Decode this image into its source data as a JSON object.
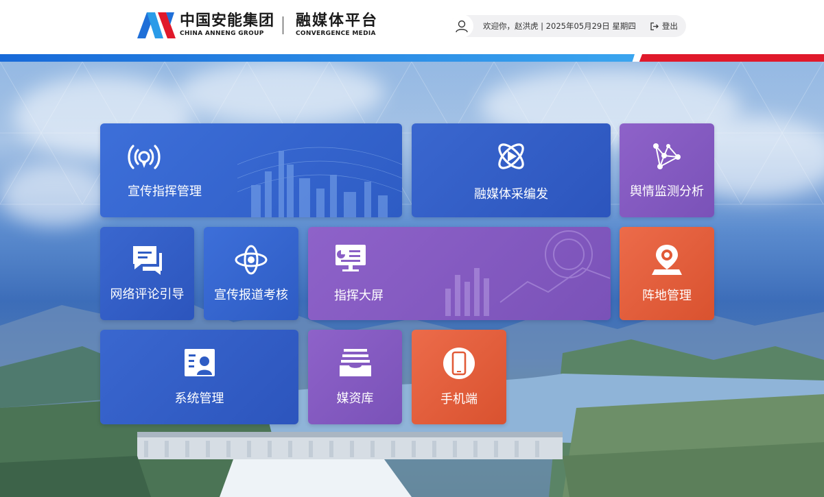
{
  "header": {
    "logo_cn": "中国安能集团",
    "logo_en": "CHINA ANNENG GROUP",
    "platform_cn": "融媒体平台",
    "platform_en": "CONVERGENCE MEDIA",
    "welcome": "欢迎你，赵洪虎 | 2025年05月29日 星期四",
    "logout_label": "登出"
  },
  "colors": {
    "blue": "#2e5cc4",
    "purple": "#7a52b8",
    "orange": "#d9522f",
    "stripe_blue": "#1e7ae0",
    "stripe_red": "#e0192b"
  },
  "tiles": [
    {
      "label": "宣传指挥管理",
      "icon": "broadcast-icon"
    },
    {
      "label": "融媒体采编发",
      "icon": "play-orbit-icon"
    },
    {
      "label": "舆情监测分析",
      "icon": "network-icon"
    },
    {
      "label": "网络评论引导",
      "icon": "chat-icon"
    },
    {
      "label": "宣传报道考核",
      "icon": "atom-icon"
    },
    {
      "label": "指挥大屏",
      "icon": "screen-icon"
    },
    {
      "label": "阵地管理",
      "icon": "location-icon"
    },
    {
      "label": "系统管理",
      "icon": "user-card-icon"
    },
    {
      "label": "媒资库",
      "icon": "inbox-icon"
    },
    {
      "label": "手机端",
      "icon": "phone-icon"
    }
  ]
}
